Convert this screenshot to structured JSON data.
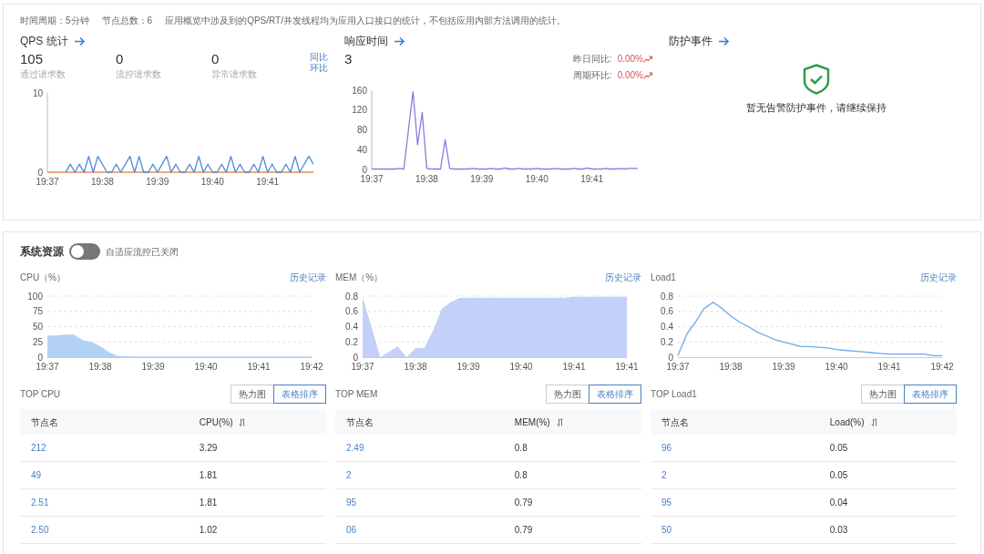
{
  "header": {
    "items": [
      "时间周期：5分钟",
      "节点总数：6",
      "应用概览中涉及到的QPS/RT/并发线程均为应用入口接口的统计，不包括应用内部方法调用的统计。"
    ]
  },
  "qps": {
    "title": "QPS 统计",
    "stats": [
      {
        "value": "105",
        "label": "通过请求数"
      },
      {
        "value": "0",
        "label": "流控请求数"
      },
      {
        "value": "0",
        "label": "异常请求数"
      }
    ],
    "compare_links": [
      "同比",
      "环比"
    ],
    "chart_data": {
      "type": "line",
      "ylim": [
        0,
        10
      ],
      "yticks": [
        0,
        10
      ],
      "categories": [
        "19:37",
        null,
        null,
        null,
        null,
        null,
        null,
        null,
        null,
        null,
        null,
        null,
        "19:38",
        null,
        null,
        null,
        null,
        null,
        null,
        null,
        null,
        null,
        null,
        null,
        "19:39",
        null,
        null,
        null,
        null,
        null,
        null,
        null,
        null,
        null,
        null,
        null,
        "19:40",
        null,
        null,
        null,
        null,
        null,
        null,
        null,
        null,
        null,
        null,
        null,
        "19:41",
        null,
        null,
        null,
        null,
        null,
        null,
        null,
        null,
        null,
        null
      ],
      "series": [
        {
          "color": "#ee8a55",
          "values": [
            0,
            0,
            0,
            0,
            0,
            0,
            0,
            0,
            0,
            0,
            0,
            0,
            0,
            0,
            0,
            0,
            0,
            0,
            0,
            0,
            0,
            0,
            0,
            0,
            0,
            0,
            0,
            0,
            0,
            0,
            0,
            0,
            0,
            0,
            0,
            0,
            0,
            0,
            0,
            0,
            0,
            0,
            0,
            0,
            0,
            0,
            0,
            0,
            0,
            0,
            0,
            0,
            0,
            0,
            0,
            0,
            0,
            0,
            0
          ]
        },
        {
          "color": "#4a8ad8",
          "values": [
            null,
            null,
            null,
            null,
            0,
            1,
            0,
            1,
            0,
            2,
            0,
            2,
            1,
            0,
            0,
            1,
            0,
            1,
            2,
            0,
            2,
            0,
            0,
            1,
            0,
            1,
            2,
            0,
            1,
            0,
            0,
            1,
            0,
            2,
            0,
            1,
            0,
            0,
            1,
            0,
            2,
            0,
            1,
            0,
            0,
            1,
            0,
            2,
            0,
            1,
            0,
            0,
            1,
            0,
            2,
            0,
            1,
            2,
            1
          ]
        }
      ]
    }
  },
  "response": {
    "title": "响应时间",
    "value": "3",
    "comparisons": [
      {
        "label": "昨日同比:",
        "value": "0.00%"
      },
      {
        "label": "周期环比:",
        "value": "0.00%"
      }
    ],
    "chart_data": {
      "type": "line",
      "ylim": [
        0,
        160
      ],
      "yticks": [
        0,
        40,
        80,
        120,
        160
      ],
      "categories": [
        "19:37",
        null,
        null,
        null,
        null,
        null,
        null,
        null,
        null,
        null,
        null,
        null,
        "19:38",
        null,
        null,
        null,
        null,
        null,
        null,
        null,
        null,
        null,
        null,
        null,
        "19:39",
        null,
        null,
        null,
        null,
        null,
        null,
        null,
        null,
        null,
        null,
        null,
        "19:40",
        null,
        null,
        null,
        null,
        null,
        null,
        null,
        null,
        null,
        null,
        null,
        "19:41",
        null,
        null,
        null,
        null,
        null,
        null,
        null,
        null,
        null,
        null
      ],
      "series": [
        {
          "color": "#8a7be0",
          "values": [
            1,
            1,
            1,
            1,
            1,
            1,
            2,
            1,
            80,
            157,
            50,
            115,
            2,
            1,
            1,
            1,
            60,
            2,
            1,
            1,
            1,
            1,
            2,
            1,
            1,
            1,
            2,
            1,
            1,
            3,
            1,
            1,
            2,
            1,
            1,
            1,
            2,
            1,
            1,
            1,
            2,
            1,
            1,
            1,
            2,
            1,
            1,
            3,
            1,
            1,
            1,
            2,
            1,
            1,
            2,
            1,
            2,
            2,
            2
          ]
        }
      ]
    }
  },
  "protection": {
    "title": "防护事件",
    "message": "暂无告警防护事件，请继续保持"
  },
  "system": {
    "title": "系统资源",
    "switch": {
      "on": false,
      "label": "自适应流控已关闭"
    },
    "charts": [
      {
        "title": "CPU（%）",
        "history_link": "历史记录",
        "chart_data": {
          "type": "area",
          "grid": true,
          "ylim": [
            0,
            100
          ],
          "yticks": [
            0,
            25,
            50,
            75,
            100
          ],
          "categories": [
            "19:37",
            null,
            null,
            null,
            null,
            null,
            "19:38",
            null,
            null,
            null,
            null,
            null,
            "19:39",
            null,
            null,
            null,
            null,
            null,
            "19:40",
            null,
            null,
            null,
            null,
            null,
            "19:41",
            null,
            null,
            null,
            null,
            null,
            "19:42"
          ],
          "series": [
            {
              "color": "#b3d1f5",
              "values": [
                35,
                36,
                37,
                37,
                28,
                25,
                18,
                8,
                2,
                2,
                1,
                1,
                1,
                1,
                1,
                1,
                1,
                1,
                1,
                1,
                1,
                1,
                1,
                1,
                1,
                1,
                1,
                1,
                1,
                1,
                1
              ]
            }
          ]
        }
      },
      {
        "title": "MEM（%）",
        "history_link": "历史记录",
        "chart_data": {
          "type": "area",
          "grid": true,
          "ylim": [
            0,
            0.8
          ],
          "yticks": [
            0,
            0.2,
            0.4,
            0.6,
            0.8
          ],
          "categories": [
            "19:37",
            null,
            null,
            null,
            null,
            null,
            "19:38",
            null,
            null,
            null,
            null,
            null,
            "19:39",
            null,
            null,
            null,
            null,
            null,
            "19:40",
            null,
            null,
            null,
            null,
            null,
            "19:41",
            null,
            null,
            null,
            null,
            null,
            "19:41"
          ],
          "series": [
            {
              "color": "#c3d1f8",
              "values": [
                0.78,
                0.4,
                0,
                0.07,
                0.14,
                0,
                0.12,
                0.12,
                0.35,
                0.64,
                0.72,
                0.78,
                0.78,
                0.78,
                0.78,
                0.78,
                0.78,
                0.78,
                0.78,
                0.78,
                0.78,
                0.78,
                0.78,
                0.78,
                0.79,
                0.79,
                0.79,
                0.79,
                0.79,
                0.79,
                0.79
              ]
            }
          ]
        }
      },
      {
        "title": "Load1",
        "history_link": "历史记录",
        "chart_data": {
          "type": "line",
          "grid": true,
          "ylim": [
            0,
            0.8
          ],
          "yticks": [
            0,
            0.2,
            0.4,
            0.6,
            0.8
          ],
          "categories": [
            "19:37",
            null,
            null,
            null,
            null,
            null,
            "19:38",
            null,
            null,
            null,
            null,
            null,
            "19:39",
            null,
            null,
            null,
            null,
            null,
            "19:40",
            null,
            null,
            null,
            null,
            null,
            "19:41",
            null,
            null,
            null,
            null,
            null,
            "19:42"
          ],
          "series": [
            {
              "color": "#6aaaf0",
              "values": [
                0.02,
                0.3,
                0.46,
                0.64,
                0.72,
                0.64,
                0.54,
                0.46,
                0.4,
                0.33,
                0.28,
                0.23,
                0.2,
                0.17,
                0.14,
                0.14,
                0.13,
                0.12,
                0.1,
                0.09,
                0.08,
                0.07,
                0.06,
                0.05,
                0.04,
                0.04,
                0.04,
                0.04,
                0.04,
                0.02,
                0.02
              ]
            }
          ]
        }
      }
    ],
    "tops": [
      {
        "title": "TOP CPU",
        "views": [
          {
            "label": "热力图",
            "selected": false
          },
          {
            "label": "表格排序",
            "selected": true
          }
        ],
        "columns": [
          "节点名",
          "CPU(%)"
        ],
        "rows": [
          [
            "212",
            "3.29"
          ],
          [
            "49",
            "1.81"
          ],
          [
            "2.51",
            "1.81"
          ],
          [
            "2.50",
            "1.02"
          ]
        ]
      },
      {
        "title": "TOP MEM",
        "views": [
          {
            "label": "热力图",
            "selected": false
          },
          {
            "label": "表格排序",
            "selected": true
          }
        ],
        "columns": [
          "节点名",
          "MEM(%)"
        ],
        "rows": [
          [
            "2.49",
            "0.8"
          ],
          [
            "2",
            "0.8"
          ],
          [
            "95",
            "0.79"
          ],
          [
            "06",
            "0.79"
          ]
        ]
      },
      {
        "title": "TOP Load1",
        "views": [
          {
            "label": "热力图",
            "selected": false
          },
          {
            "label": "表格排序",
            "selected": true
          }
        ],
        "columns": [
          "节点名",
          "Load(%)"
        ],
        "rows": [
          [
            "96",
            "0.05"
          ],
          [
            "2",
            "0.05"
          ],
          [
            "95",
            "0.04"
          ],
          [
            "50",
            "0.03"
          ]
        ]
      }
    ]
  }
}
